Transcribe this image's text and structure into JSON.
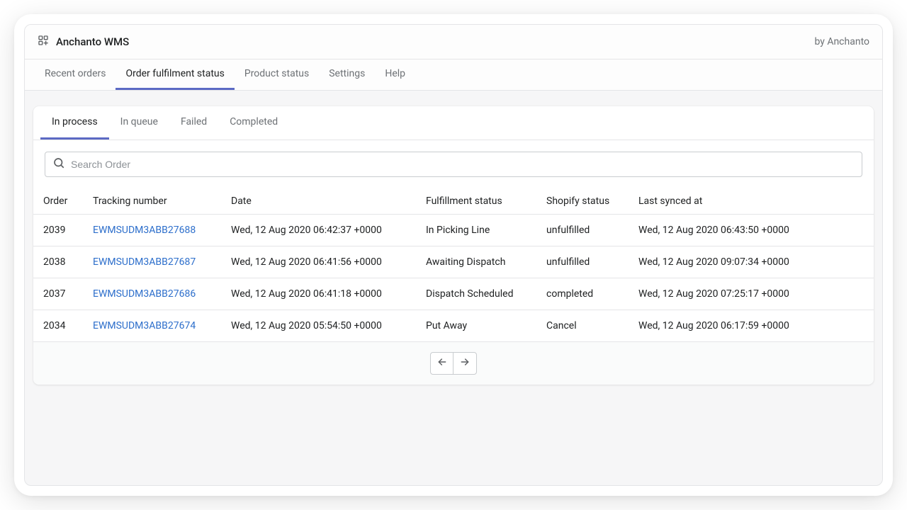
{
  "header": {
    "app_title": "Anchanto WMS",
    "by_line": "by Anchanto"
  },
  "top_tabs": [
    {
      "label": "Recent orders",
      "active": false
    },
    {
      "label": "Order fulfilment status",
      "active": true
    },
    {
      "label": "Product status",
      "active": false
    },
    {
      "label": "Settings",
      "active": false
    },
    {
      "label": "Help",
      "active": false
    }
  ],
  "sub_tabs": [
    {
      "label": "In process",
      "active": true
    },
    {
      "label": "In queue",
      "active": false
    },
    {
      "label": "Failed",
      "active": false
    },
    {
      "label": "Completed",
      "active": false
    }
  ],
  "search": {
    "placeholder": "Search Order",
    "value": ""
  },
  "table": {
    "columns": {
      "order": "Order",
      "tracking": "Tracking number",
      "date": "Date",
      "fulfillment_status": "Fulfillment status",
      "shopify_status": "Shopify status",
      "last_synced": "Last synced at"
    },
    "rows": [
      {
        "order": "2039",
        "tracking": "EWMSUDM3ABB27688",
        "date": "Wed, 12 Aug 2020 06:42:37 +0000",
        "fulfillment_status": "In Picking Line",
        "shopify_status": "unfulfilled",
        "last_synced": "Wed, 12 Aug 2020 06:43:50 +0000"
      },
      {
        "order": "2038",
        "tracking": "EWMSUDM3ABB27687",
        "date": "Wed, 12 Aug 2020 06:41:56 +0000",
        "fulfillment_status": "Awaiting Dispatch",
        "shopify_status": "unfulfilled",
        "last_synced": "Wed, 12 Aug 2020 09:07:34 +0000"
      },
      {
        "order": "2037",
        "tracking": "EWMSUDM3ABB27686",
        "date": "Wed, 12 Aug 2020 06:41:18 +0000",
        "fulfillment_status": "Dispatch Scheduled",
        "shopify_status": "completed",
        "last_synced": "Wed, 12 Aug 2020 07:25:17 +0000"
      },
      {
        "order": "2034",
        "tracking": "EWMSUDM3ABB27674",
        "date": "Wed, 12 Aug 2020 05:54:50 +0000",
        "fulfillment_status": "Put Away",
        "shopify_status": "Cancel",
        "last_synced": "Wed, 12 Aug 2020 06:17:59 +0000"
      }
    ]
  }
}
